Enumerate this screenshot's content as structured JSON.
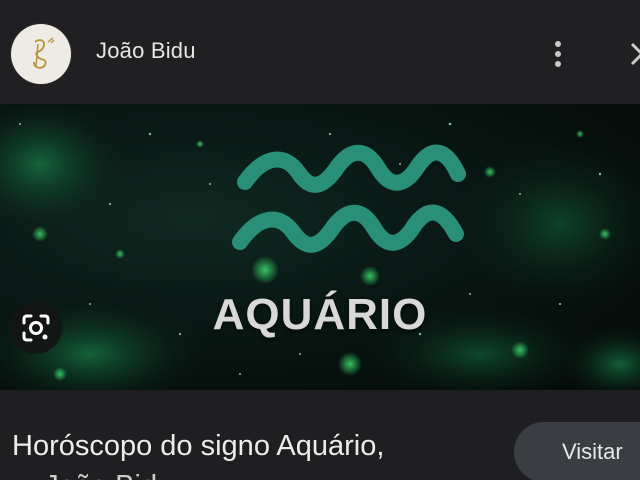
{
  "header": {
    "site_name": "João Bidu",
    "avatar_icon": "joao-bidu-logo",
    "more_icon": "more-vert-icon",
    "close_icon": "close-icon"
  },
  "image": {
    "sign_label": "AQUÁRIO",
    "sign_icon": "aquarius-symbol-icon",
    "accent_color": "#2a8f78",
    "lens_icon": "google-lens-icon"
  },
  "result": {
    "title_line1": "Horóscopo do signo Aquário,",
    "title_line2": "... João Bidu",
    "visit_label": "Visitar"
  }
}
